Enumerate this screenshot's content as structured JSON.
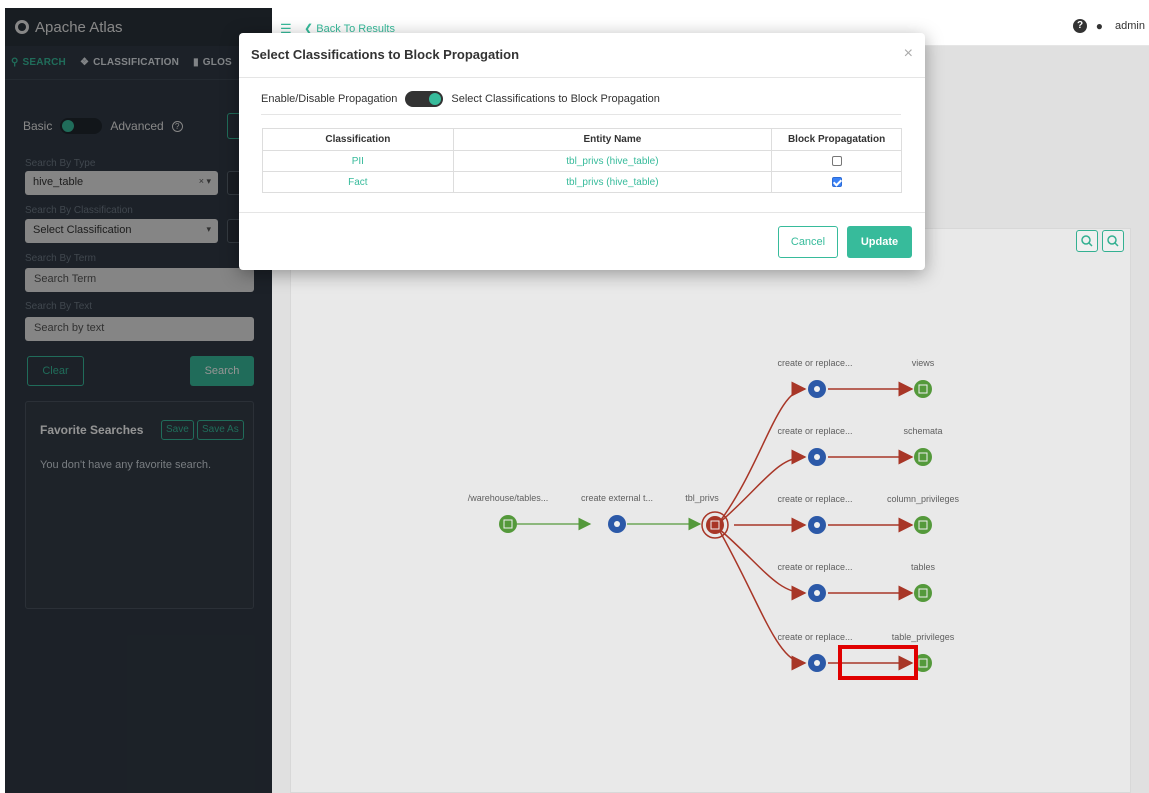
{
  "app": {
    "title": "Apache Atlas",
    "brand_color": "#37bb9b"
  },
  "sidebar": {
    "tabs": [
      {
        "label": "SEARCH",
        "icon": "search-icon",
        "active": true
      },
      {
        "label": "CLASSIFICATION",
        "icon": "tag-icon",
        "active": false
      },
      {
        "label": "GLOS",
        "icon": "folder-icon",
        "active": false
      }
    ],
    "mode": {
      "basic_label": "Basic",
      "advanced_label": "Advanced",
      "help_glyph": "?"
    },
    "type": {
      "label": "Search By Type",
      "value": "hive_table"
    },
    "classification": {
      "label": "Search By Classification",
      "placeholder": "Select Classification"
    },
    "term": {
      "label": "Search By Term",
      "placeholder": "Search Term"
    },
    "text": {
      "label": "Search By Text",
      "placeholder": "Search by text"
    },
    "clear_label": "Clear",
    "search_label": "Search",
    "favorites": {
      "title": "Favorite Searches",
      "save_label": "Save",
      "save_as_label": "Save As",
      "empty_text": "You don't have any favorite search."
    }
  },
  "topbar": {
    "back_label": "Back To Results",
    "user": "admin"
  },
  "lineage": {
    "nodes": [
      {
        "label": "/warehouse/tables..."
      },
      {
        "label": "create external t..."
      },
      {
        "label": "tbl_privs"
      },
      {
        "label": "create or replace..."
      },
      {
        "label": "views"
      },
      {
        "label": "create or replace..."
      },
      {
        "label": "schemata"
      },
      {
        "label": "create or replace..."
      },
      {
        "label": "column_privileges"
      },
      {
        "label": "create or replace..."
      },
      {
        "label": "tables"
      },
      {
        "label": "create or replace..."
      },
      {
        "label": "table_privileges"
      }
    ],
    "colors": {
      "upstream": "#5aa33f",
      "downstream": "#b33a2a",
      "process": "#2f5fb3"
    }
  },
  "modal": {
    "title": "Select Classifications to Block Propagation",
    "toggle_label": "Enable/Disable Propagation",
    "toggle_caption": "Select Classifications to Block Propagation",
    "toggle_on": true,
    "columns": [
      "Classification",
      "Entity Name",
      "Block Propagatation"
    ],
    "rows": [
      {
        "classification": "PII",
        "entity": "tbl_privs (hive_table)",
        "blocked": false
      },
      {
        "classification": "Fact",
        "entity": "tbl_privs (hive_table)",
        "blocked": true
      }
    ],
    "cancel_label": "Cancel",
    "update_label": "Update"
  }
}
